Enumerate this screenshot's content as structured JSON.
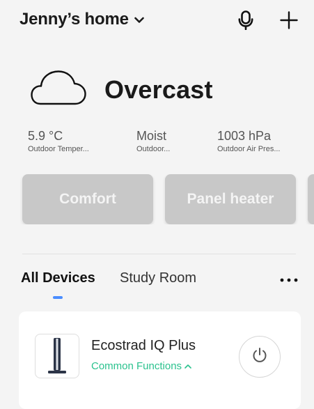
{
  "header": {
    "home_title": "Jenny’s home",
    "icons": {
      "dropdown": "chevron-down-icon",
      "mic": "microphone-icon",
      "add": "plus-icon"
    }
  },
  "weather": {
    "condition": "Overcast",
    "icon": "cloud-icon",
    "stats": [
      {
        "value": "5.9 °C",
        "label": "Outdoor Temper..."
      },
      {
        "value": "Moist",
        "label": "Outdoor..."
      },
      {
        "value": "1003 hPa",
        "label": "Outdoor Air Pres..."
      }
    ]
  },
  "scenes": {
    "cards": [
      {
        "label": "Comfort"
      },
      {
        "label": "Panel heater"
      },
      {
        "label": ""
      }
    ],
    "card_color": "#c8c8c8"
  },
  "tabs": {
    "items": [
      {
        "label": "All Devices",
        "active": true
      },
      {
        "label": "Study Room",
        "active": false
      }
    ],
    "more_icon": "more-horizontal-icon",
    "indicator_color": "#4a8dff"
  },
  "device": {
    "name": "Ecostrad IQ Plus",
    "functions_label": "Common Functions",
    "functions_icon": "chevron-up-icon",
    "power_icon": "power-icon",
    "accent_color": "#2bc28e"
  }
}
